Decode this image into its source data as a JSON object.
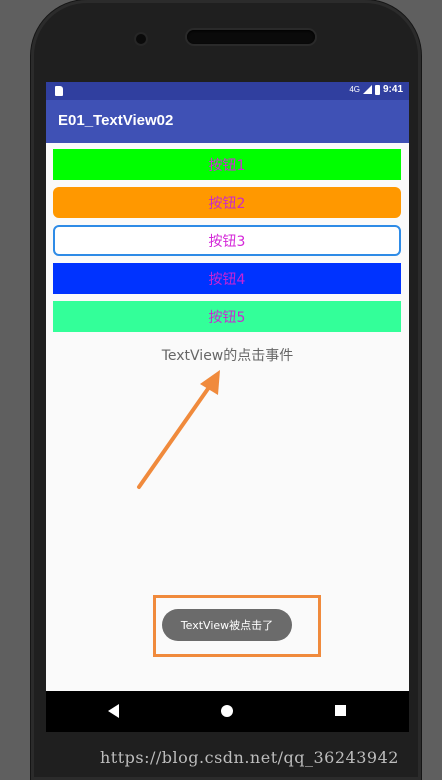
{
  "status_bar": {
    "network": "4G",
    "time": "9:41"
  },
  "toolbar": {
    "title": "E01_TextView02"
  },
  "buttons": [
    {
      "label": "按钮1",
      "bg": "#00ff00"
    },
    {
      "label": "按钮2",
      "bg": "#ff9800"
    },
    {
      "label": "按钮3",
      "bg": "#ffffff"
    },
    {
      "label": "按钮4",
      "bg": "#0033ff"
    },
    {
      "label": "按钮5",
      "bg": "#33ff99"
    }
  ],
  "textview": {
    "label": "TextView的点击事件"
  },
  "toast": {
    "message": "TextView被点击了"
  },
  "watermark": "https://blog.csdn.net/qq_36243942",
  "colors": {
    "statusbar": "#303f9f",
    "toolbar": "#3f51b5",
    "annotation": "#f08a3c",
    "button_text": "#d427d8"
  },
  "icons": {
    "back": "back-triangle-icon",
    "home": "home-circle-icon",
    "recent": "recent-square-icon"
  }
}
